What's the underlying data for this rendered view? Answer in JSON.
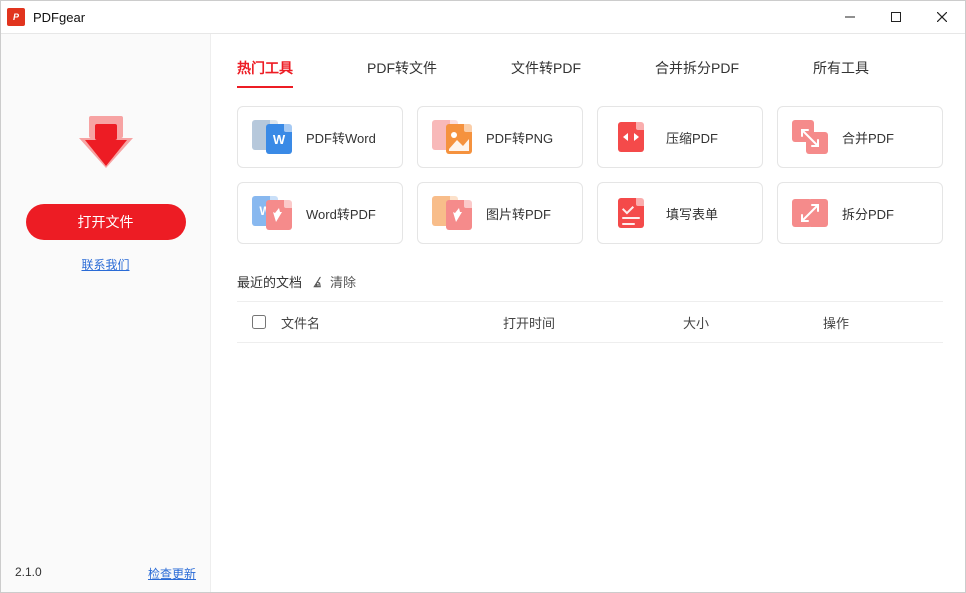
{
  "app": {
    "title": "PDFgear"
  },
  "window_controls": {
    "minimize": "minimize",
    "maximize": "maximize",
    "close": "close"
  },
  "sidebar": {
    "open_button": "打开文件",
    "contact_link": "联系我们",
    "version": "2.1.0",
    "check_update": "检查更新"
  },
  "tabs": [
    {
      "id": "hot",
      "label": "热门工具",
      "active": true
    },
    {
      "id": "pdf-to",
      "label": "PDF转文件",
      "active": false
    },
    {
      "id": "to-pdf",
      "label": "文件转PDF",
      "active": false
    },
    {
      "id": "merge",
      "label": "合并拆分PDF",
      "active": false
    },
    {
      "id": "all",
      "label": "所有工具",
      "active": false
    }
  ],
  "tools": [
    {
      "id": "pdf-to-word",
      "label": "PDF转Word"
    },
    {
      "id": "pdf-to-png",
      "label": "PDF转PNG"
    },
    {
      "id": "compress-pdf",
      "label": "压缩PDF"
    },
    {
      "id": "merge-pdf",
      "label": "合并PDF"
    },
    {
      "id": "word-to-pdf",
      "label": "Word转PDF"
    },
    {
      "id": "image-to-pdf",
      "label": "图片转PDF"
    },
    {
      "id": "fill-form",
      "label": "填写表单"
    },
    {
      "id": "split-pdf",
      "label": "拆分PDF"
    }
  ],
  "recent": {
    "title": "最近的文档",
    "clear": "清除",
    "columns": {
      "name": "文件名",
      "time": "打开时间",
      "size": "大小",
      "ops": "操作"
    },
    "rows": []
  }
}
